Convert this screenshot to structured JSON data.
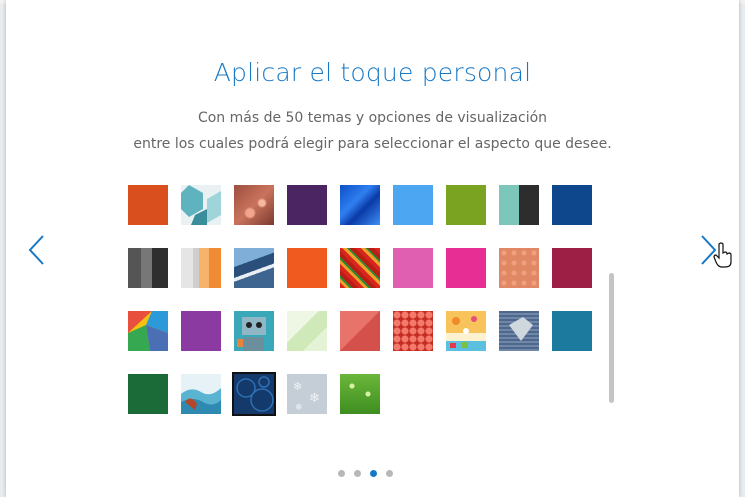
{
  "header": {
    "title": "Aplicar el toque personal",
    "subtitle_line1": "Con más de 50 temas y opciones de visualización",
    "subtitle_line2": "entre los cuales podrá elegir para seleccionar el aspecto que desee."
  },
  "nav": {
    "prev_icon": "chevron-left-icon",
    "next_icon": "chevron-right-icon"
  },
  "theme_tiles": [
    {
      "name": "orange-solid"
    },
    {
      "name": "teal-geometric"
    },
    {
      "name": "bokeh-lights"
    },
    {
      "name": "dark-purple"
    },
    {
      "name": "blue-abstract"
    },
    {
      "name": "light-blue"
    },
    {
      "name": "green-solid"
    },
    {
      "name": "teal-black-stripes"
    },
    {
      "name": "navy-blue"
    },
    {
      "name": "gray-stripes"
    },
    {
      "name": "gray-orange-stripes"
    },
    {
      "name": "mountain-sky"
    },
    {
      "name": "orange-red"
    },
    {
      "name": "colorful-pattern"
    },
    {
      "name": "pink"
    },
    {
      "name": "magenta"
    },
    {
      "name": "salmon-dots"
    },
    {
      "name": "burgundy"
    },
    {
      "name": "colorful-triangles"
    },
    {
      "name": "purple"
    },
    {
      "name": "robot"
    },
    {
      "name": "light-green-geometric"
    },
    {
      "name": "coral-geometric"
    },
    {
      "name": "red-knit"
    },
    {
      "name": "confetti"
    },
    {
      "name": "blue-heart"
    },
    {
      "name": "teal-blue"
    },
    {
      "name": "dark-green"
    },
    {
      "name": "ocean-waves"
    },
    {
      "name": "dark-blue-circles"
    },
    {
      "name": "snowflakes"
    },
    {
      "name": "green-sparkle"
    }
  ],
  "selected_theme": "dark-blue-circles",
  "pagination": {
    "pages": 4,
    "active": 3
  },
  "colors": {
    "accent": "#1778c5"
  }
}
